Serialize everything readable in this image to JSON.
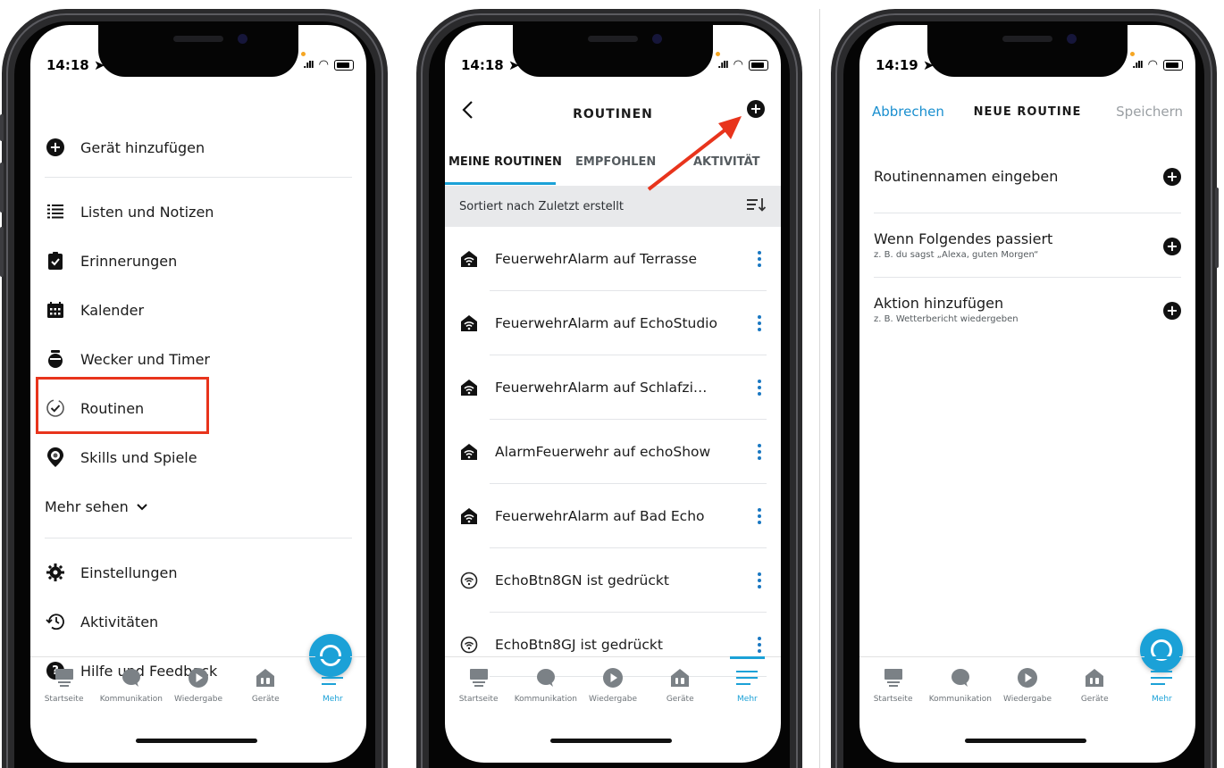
{
  "status": {
    "time_p1": "14:18",
    "time_p2": "14:18",
    "time_p3": "14:19"
  },
  "menu": {
    "items": [
      {
        "label": "Gerät hinzufügen",
        "icon": "plus-circle-icon"
      },
      {
        "label": "Listen und Notizen",
        "icon": "list-icon"
      },
      {
        "label": "Erinnerungen",
        "icon": "clipboard-check-icon"
      },
      {
        "label": "Kalender",
        "icon": "calendar-icon"
      },
      {
        "label": "Wecker und Timer",
        "icon": "alarm-clock-icon"
      },
      {
        "label": "Routinen",
        "icon": "routine-check-icon"
      },
      {
        "label": "Skills und Spiele",
        "icon": "skills-badge-icon"
      },
      {
        "label": "Einstellungen",
        "icon": "gear-icon"
      },
      {
        "label": "Aktivitäten",
        "icon": "history-icon"
      },
      {
        "label": "Hilfe und Feedback",
        "icon": "help-circle-icon"
      }
    ],
    "more": "Mehr sehen"
  },
  "tabbar": {
    "items": [
      {
        "label": "Startseite",
        "icon": "home-icon"
      },
      {
        "label": "Kommunikation",
        "icon": "chat-bubble-icon"
      },
      {
        "label": "Wiedergabe",
        "icon": "play-icon"
      },
      {
        "label": "Geräte",
        "icon": "devices-house-icon"
      },
      {
        "label": "Mehr",
        "icon": "hamburger-menu-icon"
      }
    ]
  },
  "routines": {
    "title": "ROUTINEN",
    "tabs": [
      "MEINE ROUTINEN",
      "EMPFOHLEN",
      "AKTIVITÄT"
    ],
    "sort_label": "Sortiert nach Zuletzt erstellt",
    "items": [
      {
        "label": "FeuerwehrAlarm auf Terrasse",
        "icon": "smart-home-icon"
      },
      {
        "label": "FeuerwehrAlarm auf EchoStudio",
        "icon": "smart-home-icon"
      },
      {
        "label": "FeuerwehrAlarm auf Schlafzi…",
        "icon": "smart-home-icon"
      },
      {
        "label": "AlarmFeuerwehr auf echoShow",
        "icon": "smart-home-icon"
      },
      {
        "label": "FeuerwehrAlarm auf Bad Echo",
        "icon": "smart-home-icon"
      },
      {
        "label": "EchoBtn8GN ist gedrückt",
        "icon": "echo-button-icon"
      },
      {
        "label": "EchoBtn8GJ ist gedrückt",
        "icon": "echo-button-icon"
      }
    ]
  },
  "new_routine": {
    "cancel": "Abbrechen",
    "title": "NEUE ROUTINE",
    "save": "Speichern",
    "rows": [
      {
        "title": "Routinennamen eingeben",
        "sub": ""
      },
      {
        "title": "Wenn Folgendes passiert",
        "sub": "z. B. du sagst „Alexa, guten Morgen“"
      },
      {
        "title": "Aktion hinzufügen",
        "sub": "z. B. Wetterbericht wiedergeben"
      }
    ]
  },
  "colors": {
    "accent": "#1ba1d7",
    "highlight": "#e8341c",
    "link": "#1a8fcf"
  }
}
